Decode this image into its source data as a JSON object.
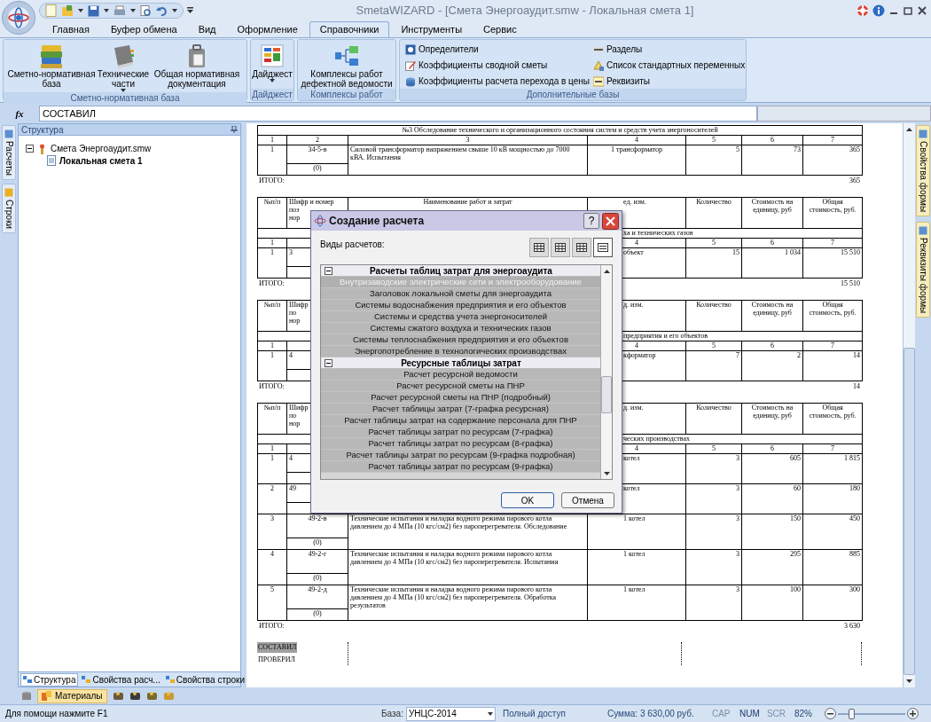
{
  "app": {
    "title": "SmetaWIZARD - [Смета Энергоаудит.smw - Локальная смета 1]"
  },
  "ribbon": {
    "tabs": [
      {
        "label": "Главная",
        "selected": false
      },
      {
        "label": "Буфер обмена",
        "selected": false
      },
      {
        "label": "Вид",
        "selected": false
      },
      {
        "label": "Оформление",
        "selected": false
      },
      {
        "label": "Справочники",
        "selected": true
      },
      {
        "label": "Инструменты",
        "selected": false
      },
      {
        "label": "Сервис",
        "selected": false
      }
    ],
    "groups": [
      {
        "kind": "large",
        "label": "Сметно-нормативная база",
        "buttons": [
          {
            "label": "Сметно-нормативная база",
            "has_menu": false
          },
          {
            "label": "Технические части",
            "has_menu": true
          },
          {
            "label": "Общая нормативная документация",
            "has_menu": false
          }
        ]
      },
      {
        "kind": "large",
        "label": "Дайджест",
        "buttons": [
          {
            "label": "Дайджест",
            "has_menu": true
          }
        ]
      },
      {
        "kind": "large",
        "label": "Комплексы работ",
        "buttons": [
          {
            "label": "Комплексы работ дефектной ведомости",
            "has_menu": false
          }
        ]
      },
      {
        "kind": "small",
        "label": "Дополнительные базы",
        "buttons": [
          {
            "label": "Определители"
          },
          {
            "label": "Коэффициенты сводной сметы"
          },
          {
            "label": "Коэффициенты расчета перехода в цены"
          },
          {
            "label": "Разделы"
          },
          {
            "label": "Список стандартных переменных"
          },
          {
            "label": "Реквизиты"
          }
        ]
      }
    ]
  },
  "formula_bar": {
    "label": "fx",
    "value": "СОСТАВИЛ"
  },
  "left_strip": [
    {
      "label": "Расчеты"
    },
    {
      "label": "Строки"
    }
  ],
  "right_strip": [
    {
      "label": "Свойства формы"
    },
    {
      "label": "Реквизиты формы"
    }
  ],
  "panel": {
    "title": "Структура",
    "tree": [
      {
        "label": "Смета Энергоаудит.smw",
        "expanded": true,
        "selected": false,
        "children": [
          {
            "label": "Локальная смета 1",
            "selected": true
          }
        ]
      }
    ],
    "tabs": [
      {
        "label": "Структура",
        "selected": true
      },
      {
        "label": "Свойства расч...",
        "selected": false
      },
      {
        "label": "Свойства строки",
        "selected": false
      }
    ]
  },
  "document": {
    "sections": [
      {
        "title": "№3 Обследование технического и организационного состояния систем и средств учета энергоносителей",
        "numbers": {
          "c1": "1",
          "c2": "2",
          "c3": "3",
          "c4": "4",
          "c5": "5",
          "c6": "6",
          "c7": "7"
        },
        "rows": [
          {
            "no": "1",
            "code": "34-5-в",
            "note": "(0)",
            "name": "Силовой трансформатор напряжением свыше 10 кВ мощностью до 7000 кВА. Испытания",
            "unit": "1 трансформатор",
            "qty": "5",
            "price": "73",
            "total": "365"
          }
        ],
        "total_label": "ИТОГО:",
        "total": "365"
      },
      {
        "header": {
          "no": "№п/п",
          "code": [
            "Шифр и номер",
            "поз",
            "нор"
          ],
          "name": "Наименование работ и затрат",
          "unit": "ед. изм.",
          "qty": "Количество",
          "price": "Стоимость на единицу, руб",
          "total": "Общая стоимость, руб."
        },
        "title_tail": "ха и технических газов",
        "numbers": {
          "c1": "1",
          "c4": "4",
          "c5": "5",
          "c6": "6",
          "c7": "7"
        },
        "rows": [
          {
            "no": "1",
            "code": "3",
            "unit": "объект",
            "qty": "15",
            "price": "1 034",
            "total": "15 510"
          }
        ],
        "total_label": "ИТОГО:",
        "total": "15 510"
      },
      {
        "header": {
          "no": "№п/п",
          "code": [
            "Шифр",
            "по",
            "нор"
          ],
          "unit": "д. изм.",
          "qty": "Количество",
          "price": "Стоимость на единицу, руб",
          "total": "Общая стоимость, руб."
        },
        "title_tail": "предприятия и его объектов",
        "numbers": {
          "c1": "1",
          "c4": "4",
          "c5": "5",
          "c6": "6",
          "c7": "7"
        },
        "rows": [
          {
            "no": "1",
            "code": "4",
            "unit": "кформатор",
            "qty": "7",
            "price": "2",
            "total": "14"
          }
        ],
        "total_label": "ИТОГО:",
        "total": "14"
      },
      {
        "header": {
          "no": "№п/п",
          "code": [
            "Шифр",
            "по",
            "нор"
          ],
          "unit": "д. изм.",
          "qty": "Количество",
          "price": "Стоимость на единицу, руб",
          "total": "Общая стоимость, руб."
        },
        "title_tail": "ческих производствах",
        "numbers": {
          "c1": "1",
          "c4": "4",
          "c5": "5",
          "c6": "6",
          "c7": "7"
        },
        "rows": [
          {
            "no": "1",
            "code": "4",
            "unit": "котел",
            "qty": "3",
            "price": "605",
            "total": "1 815"
          },
          {
            "no": "2",
            "code": "49",
            "unit": "котел",
            "qty": "3",
            "price": "60",
            "total": "180"
          },
          {
            "no": "3",
            "code": "49-2-в",
            "note": "(0)",
            "name": "Технические испытания и наладка водного режима парового котла давлением до 4 МПа (10 кгс/см2) без пароперегревателя. Обследование",
            "unit": "1 котел",
            "qty": "3",
            "price": "150",
            "total": "450"
          },
          {
            "no": "4",
            "code": "49-2-г",
            "note": "(0)",
            "name": "Технические испытания и наладка водного режима парового котла давлением до 4 МПа (10 кгс/см2) без пароперегревателя. Испытания",
            "unit": "1 котел",
            "qty": "3",
            "price": "295",
            "total": "885"
          },
          {
            "no": "5",
            "code": "49-2-д",
            "note": "(0)",
            "name": "Технические испытания и наладка водного режима парового котла давлением до 4 МПа (10 кгс/см2) без пароперегревателя. Обработка результатов",
            "unit": "1 котел",
            "qty": "3",
            "price": "100",
            "total": "300"
          }
        ],
        "total_label": "ИТОГО:",
        "total": "3 630"
      }
    ],
    "signatures": [
      {
        "label": "СОСТАВИЛ",
        "selected": true
      },
      {
        "label": "ПРОВЕРИЛ",
        "selected": false
      }
    ]
  },
  "dialog": {
    "title": "Создание расчета",
    "help": "?",
    "label": "Виды расчетов:",
    "views": [
      {
        "selected": false
      },
      {
        "selected": false
      },
      {
        "selected": false
      },
      {
        "selected": true
      }
    ],
    "groups": [
      {
        "label": "Расчеты таблиц затрат для энергоаудита",
        "expanded": true,
        "items": [
          {
            "label": "Внутризаводские электрические сети и электрооборудование",
            "selected": true
          },
          {
            "label": "Заголовок локальной сметы для энергоаудита",
            "selected": false
          },
          {
            "label": "Системы водоснабжения предприятия и его объектов",
            "selected": false
          },
          {
            "label": "Системы и средства учета энергоносителей",
            "selected": false
          },
          {
            "label": "Системы сжатого воздуха и технических газов",
            "selected": false
          },
          {
            "label": "Системы теплоснабжения предприятия и его объектов",
            "selected": false
          },
          {
            "label": "Энергопотребление в технологических производствах",
            "selected": false
          }
        ]
      },
      {
        "label": "Ресурсные таблицы затрат",
        "expanded": true,
        "items": [
          {
            "label": "Расчет ресурсной ведомости",
            "selected": false
          },
          {
            "label": "Расчет ресурсной сметы на ПНР",
            "selected": false
          },
          {
            "label": "Расчет ресурсной сметы на ПНР (подробный)",
            "selected": false
          },
          {
            "label": "Расчет таблицы затрат (7-графка ресурсная)",
            "selected": false
          },
          {
            "label": "Расчет таблицы затрат на содержание персонала для ПНР",
            "selected": false
          },
          {
            "label": "Расчет таблицы затрат по ресурсам (7-графка)",
            "selected": false
          },
          {
            "label": "Расчет таблицы затрат по ресурсам (8-графка)",
            "selected": false
          },
          {
            "label": "Расчет таблицы затрат по ресурсам (9-графка подробная)",
            "selected": false
          },
          {
            "label": "Расчет таблицы затрат по ресурсам (9-графка)",
            "selected": false
          }
        ]
      }
    ],
    "buttons": [
      "OK",
      "Отмена"
    ]
  },
  "toolbar": {
    "materials": "Материалы"
  },
  "status_bar": {
    "help": "Для помощи нажмите F1",
    "base_label": "База:",
    "base_value": "УНЦС-2014",
    "access": "Полный доступ",
    "sum": "Сумма: 3 630,00 руб.",
    "indicators": [
      {
        "label": "CAP",
        "on": false
      },
      {
        "label": "NUM",
        "on": true
      },
      {
        "label": "SCR",
        "on": false
      }
    ],
    "zoom": "82%",
    "zoom_slider": {
      "level": 0.2
    }
  }
}
